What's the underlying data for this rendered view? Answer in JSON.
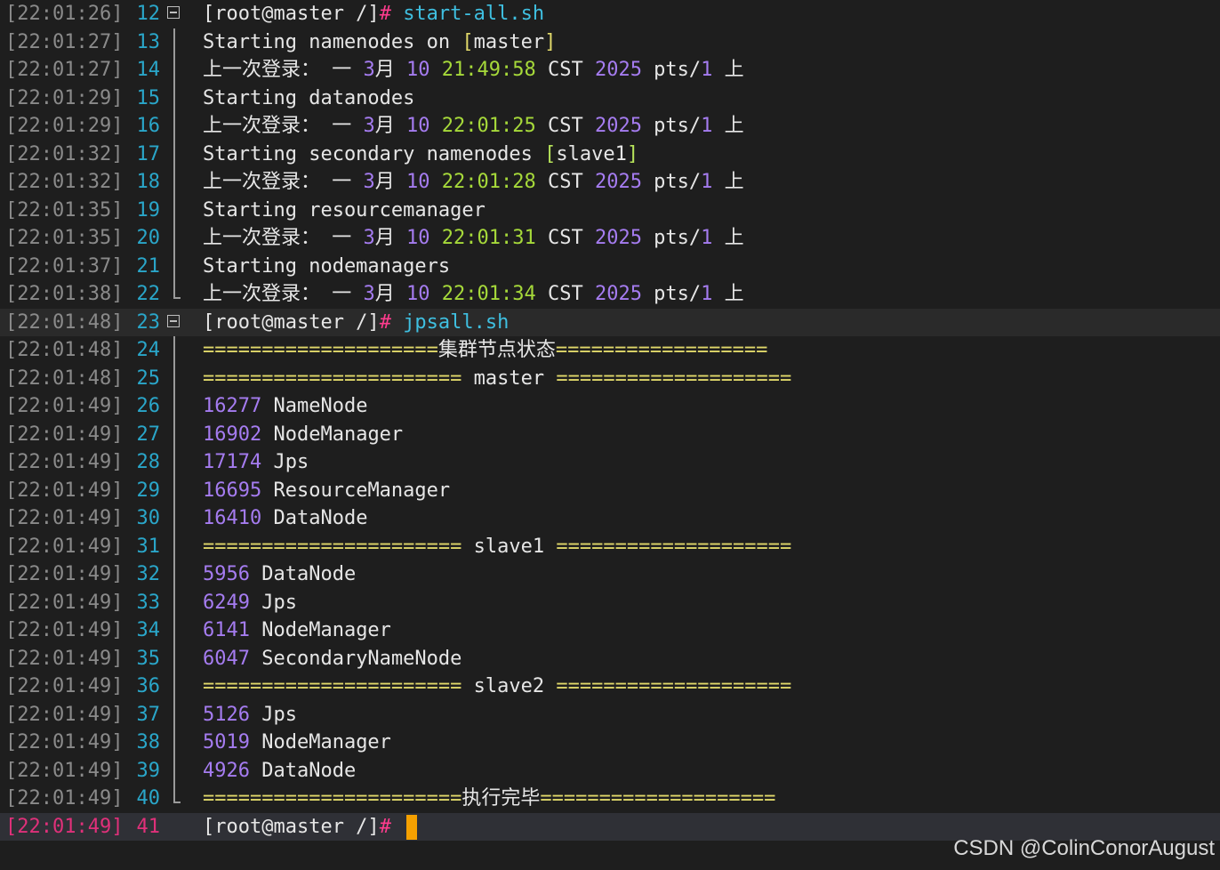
{
  "watermark": "CSDN @ColinConorAugust",
  "lines": [
    {
      "ts": "[22:01:26]",
      "ln": "12",
      "fold": "box",
      "segs": [
        {
          "t": "[root@master /]",
          "c": "w"
        },
        {
          "t": "# ",
          "c": "pink"
        },
        {
          "t": "start-all.sh",
          "c": "cyan"
        }
      ]
    },
    {
      "ts": "[22:01:27]",
      "ln": "13",
      "fold": "mid",
      "segs": [
        {
          "t": "Starting namenodes on ",
          "c": "w"
        },
        {
          "t": "[",
          "c": "yellow"
        },
        {
          "t": "master",
          "c": "w"
        },
        {
          "t": "]",
          "c": "yellow"
        }
      ]
    },
    {
      "ts": "[22:01:27]",
      "ln": "14",
      "fold": "mid",
      "segs": [
        {
          "t": "上一次登录： 一 ",
          "c": "w"
        },
        {
          "t": "3",
          "c": "purple"
        },
        {
          "t": "月 ",
          "c": "w"
        },
        {
          "t": "10",
          "c": "purple"
        },
        {
          "t": " ",
          "c": "w"
        },
        {
          "t": "21:49:58",
          "c": "lime"
        },
        {
          "t": " CST ",
          "c": "w"
        },
        {
          "t": "2025",
          "c": "purple"
        },
        {
          "t": " pts/",
          "c": "w"
        },
        {
          "t": "1",
          "c": "purple"
        },
        {
          "t": " 上",
          "c": "w"
        }
      ]
    },
    {
      "ts": "[22:01:29]",
      "ln": "15",
      "fold": "mid",
      "segs": [
        {
          "t": "Starting datanodes",
          "c": "w"
        }
      ]
    },
    {
      "ts": "[22:01:29]",
      "ln": "16",
      "fold": "mid",
      "segs": [
        {
          "t": "上一次登录： 一 ",
          "c": "w"
        },
        {
          "t": "3",
          "c": "purple"
        },
        {
          "t": "月 ",
          "c": "w"
        },
        {
          "t": "10",
          "c": "purple"
        },
        {
          "t": " ",
          "c": "w"
        },
        {
          "t": "22:01:25",
          "c": "lime"
        },
        {
          "t": " CST ",
          "c": "w"
        },
        {
          "t": "2025",
          "c": "purple"
        },
        {
          "t": " pts/",
          "c": "w"
        },
        {
          "t": "1",
          "c": "purple"
        },
        {
          "t": " 上",
          "c": "w"
        }
      ]
    },
    {
      "ts": "[22:01:32]",
      "ln": "17",
      "fold": "mid",
      "segs": [
        {
          "t": "Starting secondary namenodes ",
          "c": "w"
        },
        {
          "t": "[",
          "c": "green"
        },
        {
          "t": "slave1",
          "c": "w"
        },
        {
          "t": "]",
          "c": "green"
        }
      ]
    },
    {
      "ts": "[22:01:32]",
      "ln": "18",
      "fold": "mid",
      "segs": [
        {
          "t": "上一次登录： 一 ",
          "c": "w"
        },
        {
          "t": "3",
          "c": "purple"
        },
        {
          "t": "月 ",
          "c": "w"
        },
        {
          "t": "10",
          "c": "purple"
        },
        {
          "t": " ",
          "c": "w"
        },
        {
          "t": "22:01:28",
          "c": "lime"
        },
        {
          "t": " CST ",
          "c": "w"
        },
        {
          "t": "2025",
          "c": "purple"
        },
        {
          "t": " pts/",
          "c": "w"
        },
        {
          "t": "1",
          "c": "purple"
        },
        {
          "t": " 上",
          "c": "w"
        }
      ]
    },
    {
      "ts": "[22:01:35]",
      "ln": "19",
      "fold": "mid",
      "segs": [
        {
          "t": "Starting resourcemanager",
          "c": "w"
        }
      ]
    },
    {
      "ts": "[22:01:35]",
      "ln": "20",
      "fold": "mid",
      "segs": [
        {
          "t": "上一次登录： 一 ",
          "c": "w"
        },
        {
          "t": "3",
          "c": "purple"
        },
        {
          "t": "月 ",
          "c": "w"
        },
        {
          "t": "10",
          "c": "purple"
        },
        {
          "t": " ",
          "c": "w"
        },
        {
          "t": "22:01:31",
          "c": "lime"
        },
        {
          "t": " CST ",
          "c": "w"
        },
        {
          "t": "2025",
          "c": "purple"
        },
        {
          "t": " pts/",
          "c": "w"
        },
        {
          "t": "1",
          "c": "purple"
        },
        {
          "t": " 上",
          "c": "w"
        }
      ]
    },
    {
      "ts": "[22:01:37]",
      "ln": "21",
      "fold": "mid",
      "segs": [
        {
          "t": "Starting nodemanagers",
          "c": "w"
        }
      ]
    },
    {
      "ts": "[22:01:38]",
      "ln": "22",
      "fold": "end",
      "segs": [
        {
          "t": "上一次登录： 一 ",
          "c": "w"
        },
        {
          "t": "3",
          "c": "purple"
        },
        {
          "t": "月 ",
          "c": "w"
        },
        {
          "t": "10",
          "c": "purple"
        },
        {
          "t": " ",
          "c": "w"
        },
        {
          "t": "22:01:34",
          "c": "lime"
        },
        {
          "t": " CST ",
          "c": "w"
        },
        {
          "t": "2025",
          "c": "purple"
        },
        {
          "t": " pts/",
          "c": "w"
        },
        {
          "t": "1",
          "c": "purple"
        },
        {
          "t": " 上",
          "c": "w"
        }
      ]
    },
    {
      "ts": "[22:01:48]",
      "ln": "23",
      "fold": "box",
      "hl": true,
      "segs": [
        {
          "t": "[root@master /]",
          "c": "w"
        },
        {
          "t": "# ",
          "c": "pink"
        },
        {
          "t": "jpsall.sh",
          "c": "cyan"
        }
      ]
    },
    {
      "ts": "[22:01:48]",
      "ln": "24",
      "fold": "mid",
      "segs": [
        {
          "t": "====================",
          "c": "yellow"
        },
        {
          "t": "集群节点状态",
          "c": "w"
        },
        {
          "t": "==================",
          "c": "yellow"
        }
      ]
    },
    {
      "ts": "[22:01:48]",
      "ln": "25",
      "fold": "mid",
      "segs": [
        {
          "t": "====================== ",
          "c": "yellow"
        },
        {
          "t": "master",
          "c": "w"
        },
        {
          "t": " ====================",
          "c": "yellow"
        }
      ]
    },
    {
      "ts": "[22:01:49]",
      "ln": "26",
      "fold": "mid",
      "segs": [
        {
          "t": "16277",
          "c": "purple"
        },
        {
          "t": " NameNode",
          "c": "w"
        }
      ]
    },
    {
      "ts": "[22:01:49]",
      "ln": "27",
      "fold": "mid",
      "segs": [
        {
          "t": "16902",
          "c": "purple"
        },
        {
          "t": " NodeManager",
          "c": "w"
        }
      ]
    },
    {
      "ts": "[22:01:49]",
      "ln": "28",
      "fold": "mid",
      "segs": [
        {
          "t": "17174",
          "c": "purple"
        },
        {
          "t": " Jps",
          "c": "w"
        }
      ]
    },
    {
      "ts": "[22:01:49]",
      "ln": "29",
      "fold": "mid",
      "segs": [
        {
          "t": "16695",
          "c": "purple"
        },
        {
          "t": " ResourceManager",
          "c": "w"
        }
      ]
    },
    {
      "ts": "[22:01:49]",
      "ln": "30",
      "fold": "mid",
      "segs": [
        {
          "t": "16410",
          "c": "purple"
        },
        {
          "t": " DataNode",
          "c": "w"
        }
      ]
    },
    {
      "ts": "[22:01:49]",
      "ln": "31",
      "fold": "mid",
      "segs": [
        {
          "t": "====================== ",
          "c": "yellow"
        },
        {
          "t": "slave1",
          "c": "w"
        },
        {
          "t": " ====================",
          "c": "yellow"
        }
      ]
    },
    {
      "ts": "[22:01:49]",
      "ln": "32",
      "fold": "mid",
      "segs": [
        {
          "t": "5956",
          "c": "purple"
        },
        {
          "t": " DataNode",
          "c": "w"
        }
      ]
    },
    {
      "ts": "[22:01:49]",
      "ln": "33",
      "fold": "mid",
      "segs": [
        {
          "t": "6249",
          "c": "purple"
        },
        {
          "t": " Jps",
          "c": "w"
        }
      ]
    },
    {
      "ts": "[22:01:49]",
      "ln": "34",
      "fold": "mid",
      "segs": [
        {
          "t": "6141",
          "c": "purple"
        },
        {
          "t": " NodeManager",
          "c": "w"
        }
      ]
    },
    {
      "ts": "[22:01:49]",
      "ln": "35",
      "fold": "mid",
      "segs": [
        {
          "t": "6047",
          "c": "purple"
        },
        {
          "t": " SecondaryNameNode",
          "c": "w"
        }
      ]
    },
    {
      "ts": "[22:01:49]",
      "ln": "36",
      "fold": "mid",
      "segs": [
        {
          "t": "====================== ",
          "c": "yellow"
        },
        {
          "t": "slave2",
          "c": "w"
        },
        {
          "t": " ====================",
          "c": "yellow"
        }
      ]
    },
    {
      "ts": "[22:01:49]",
      "ln": "37",
      "fold": "mid",
      "segs": [
        {
          "t": "5126",
          "c": "purple"
        },
        {
          "t": " Jps",
          "c": "w"
        }
      ]
    },
    {
      "ts": "[22:01:49]",
      "ln": "38",
      "fold": "mid",
      "segs": [
        {
          "t": "5019",
          "c": "purple"
        },
        {
          "t": " NodeManager",
          "c": "w"
        }
      ]
    },
    {
      "ts": "[22:01:49]",
      "ln": "39",
      "fold": "mid",
      "segs": [
        {
          "t": "4926",
          "c": "purple"
        },
        {
          "t": " DataNode",
          "c": "w"
        }
      ]
    },
    {
      "ts": "[22:01:49]",
      "ln": "40",
      "fold": "end",
      "segs": [
        {
          "t": "======================",
          "c": "yellow"
        },
        {
          "t": "执行完毕",
          "c": "w"
        },
        {
          "t": "====================",
          "c": "yellow"
        }
      ]
    },
    {
      "ts": "[22:01:49]",
      "ln": "41",
      "fold": "",
      "cur": true,
      "segs": [
        {
          "t": "[root@master /]",
          "c": "w"
        },
        {
          "t": "# ",
          "c": "pink"
        }
      ]
    }
  ]
}
